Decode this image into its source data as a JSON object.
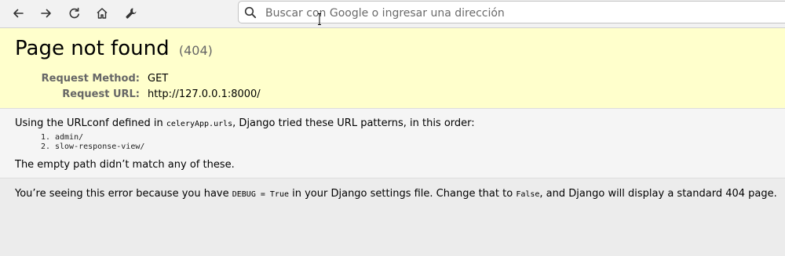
{
  "browser": {
    "address_placeholder": "Buscar con Google o ingresar una dirección",
    "icons": [
      "back-arrow-icon",
      "forward-arrow-icon",
      "reload-icon",
      "home-icon",
      "wrench-icon",
      "search-icon"
    ]
  },
  "error": {
    "title": "Page not found",
    "code": "(404)",
    "request_method_label": "Request Method:",
    "request_method": "GET",
    "request_url_label": "Request URL:",
    "request_url": "http://127.0.0.1:8000/"
  },
  "info": {
    "intro_before": "Using the URLconf defined in ",
    "urlconf": "celeryApp.urls",
    "intro_after": ", Django tried these URL patterns, in this order:",
    "patterns": [
      "admin/",
      "slow-response-view/"
    ],
    "no_match": "The empty path didn’t match any of these."
  },
  "explanation": {
    "part1": "You’re seeing this error because you have ",
    "debug_setting": "DEBUG = True",
    "part2": " in your Django settings file. Change that to ",
    "false_value": "False",
    "part3": ", and Django will display a standard 404 page."
  }
}
